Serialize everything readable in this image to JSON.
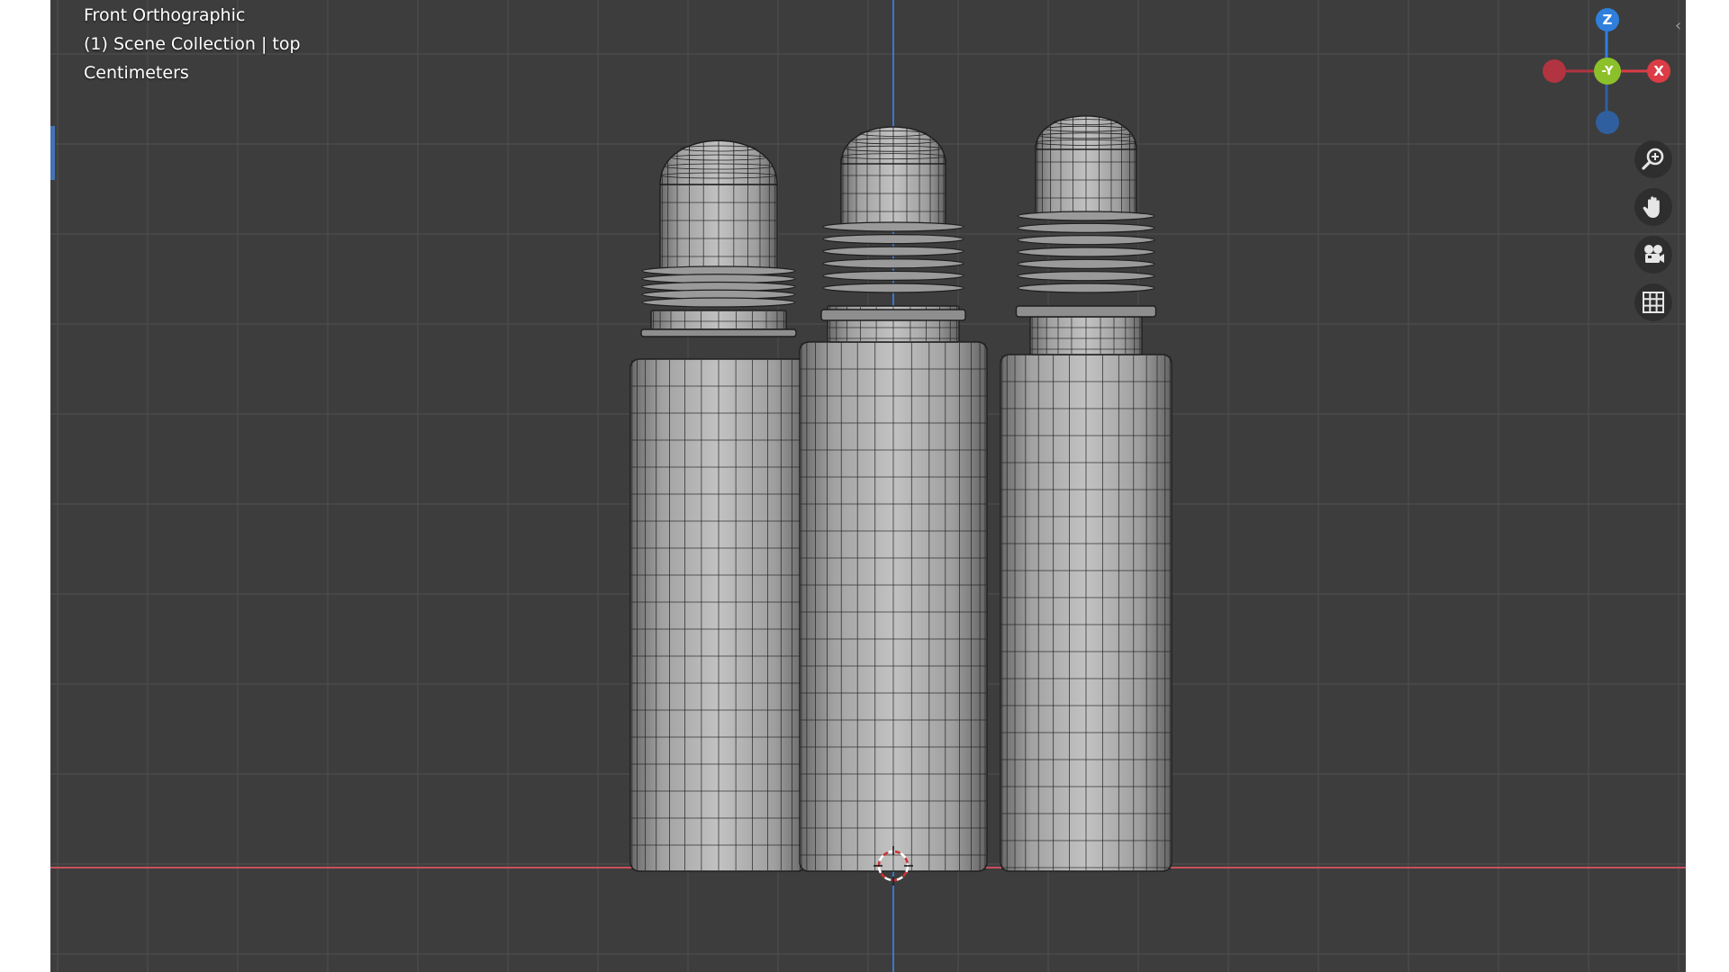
{
  "viewport": {
    "view_name": "Front Orthographic",
    "collection_label": "(1) Scene Collection | top",
    "units": "Centimeters",
    "colors": {
      "background": "#3d3d3d",
      "grid_line": "#4b4b4b",
      "x_axis": "#c8505a",
      "z_axis": "#3e78c8",
      "mesh_fill": "#a6a6a6",
      "wire": "#1e1e1e"
    }
  },
  "gizmo": {
    "z_label": "Z",
    "y_label": "-Y",
    "x_label": "X",
    "colors": {
      "z": "#2f7fdc",
      "y": "#8bc02a",
      "x": "#dc3c46",
      "neg_x": "#b13440",
      "neg_z": "#2f5f9f"
    }
  },
  "nav_tools": [
    {
      "name": "zoom-icon",
      "label": "zoom"
    },
    {
      "name": "hand-icon",
      "label": "pan"
    },
    {
      "name": "camera-icon",
      "label": "camera view"
    },
    {
      "name": "grid-icon",
      "label": "toggle orthographic"
    }
  ],
  "objects": [
    {
      "name": "bottle-left"
    },
    {
      "name": "bottle-middle"
    },
    {
      "name": "bottle-right"
    }
  ]
}
